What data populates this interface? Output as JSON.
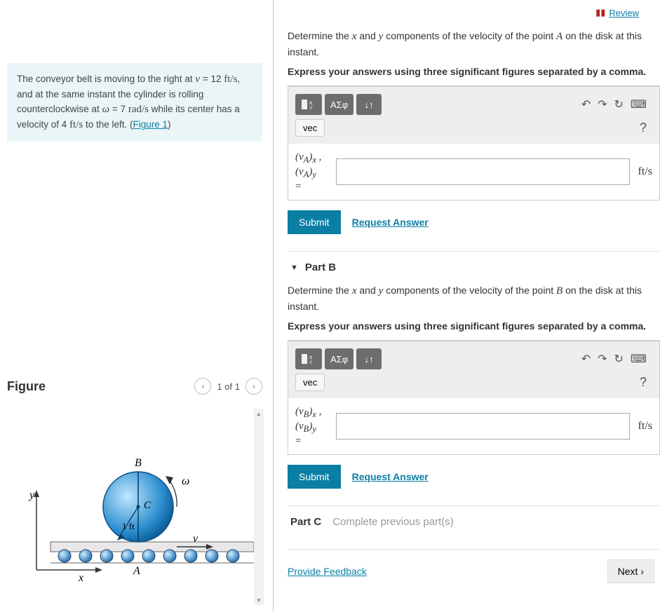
{
  "review_label": "Review",
  "problem_statement": {
    "prefix": "The conveyor belt is moving to the right at ",
    "v_sym": "v",
    "v_eq": " = 12 ",
    "v_unit": "ft/s",
    "mid1": ", and at the same instant the cylinder is rolling counterclockwise at ",
    "w_sym": "ω",
    "w_eq": " = 7  ",
    "w_unit": "rad/s",
    "mid2": " while its center has a velocity of 4 ",
    "c_unit": "ft/s",
    "tail": " to the left. (",
    "figure_link": "Figure 1",
    "close": ")"
  },
  "figure": {
    "heading": "Figure",
    "pager": "1 of 1",
    "labels": {
      "B": "B",
      "C": "C",
      "A": "A",
      "x": "x",
      "y": "y",
      "v": "v",
      "w": "ω",
      "r": "1 ft"
    }
  },
  "partA": {
    "question_pre": "Determine the ",
    "x": "x",
    "and": " and ",
    "y": "y",
    "question_post": " components of the velocity of the point ",
    "pt": "A",
    "question_tail": " on the disk at this instant.",
    "instruction": "Express your answers using three significant figures separated by a comma.",
    "greek_btn": "ΑΣφ",
    "vec_btn": "vec",
    "var_l1": "(v_A)_x ,",
    "var_l2": "(v_A)_y",
    "eq": "=",
    "unit": "ft/s",
    "submit": "Submit",
    "request": "Request Answer"
  },
  "partB": {
    "header": "Part B",
    "question_pre": "Determine the ",
    "x": "x",
    "and": " and ",
    "y": "y",
    "question_post": " components of the velocity of the point ",
    "pt": "B",
    "question_tail": " on the disk at this instant.",
    "instruction": "Express your answers using three significant figures separated by a comma.",
    "greek_btn": "ΑΣφ",
    "vec_btn": "vec",
    "var_l1": "(v_B)_x ,",
    "var_l2": "(v_B)_y",
    "eq": "=",
    "unit": "ft/s",
    "submit": "Submit",
    "request": "Request Answer"
  },
  "partC": {
    "header": "Part C",
    "locked": "Complete previous part(s)"
  },
  "feedback": "Provide Feedback",
  "next": "Next"
}
